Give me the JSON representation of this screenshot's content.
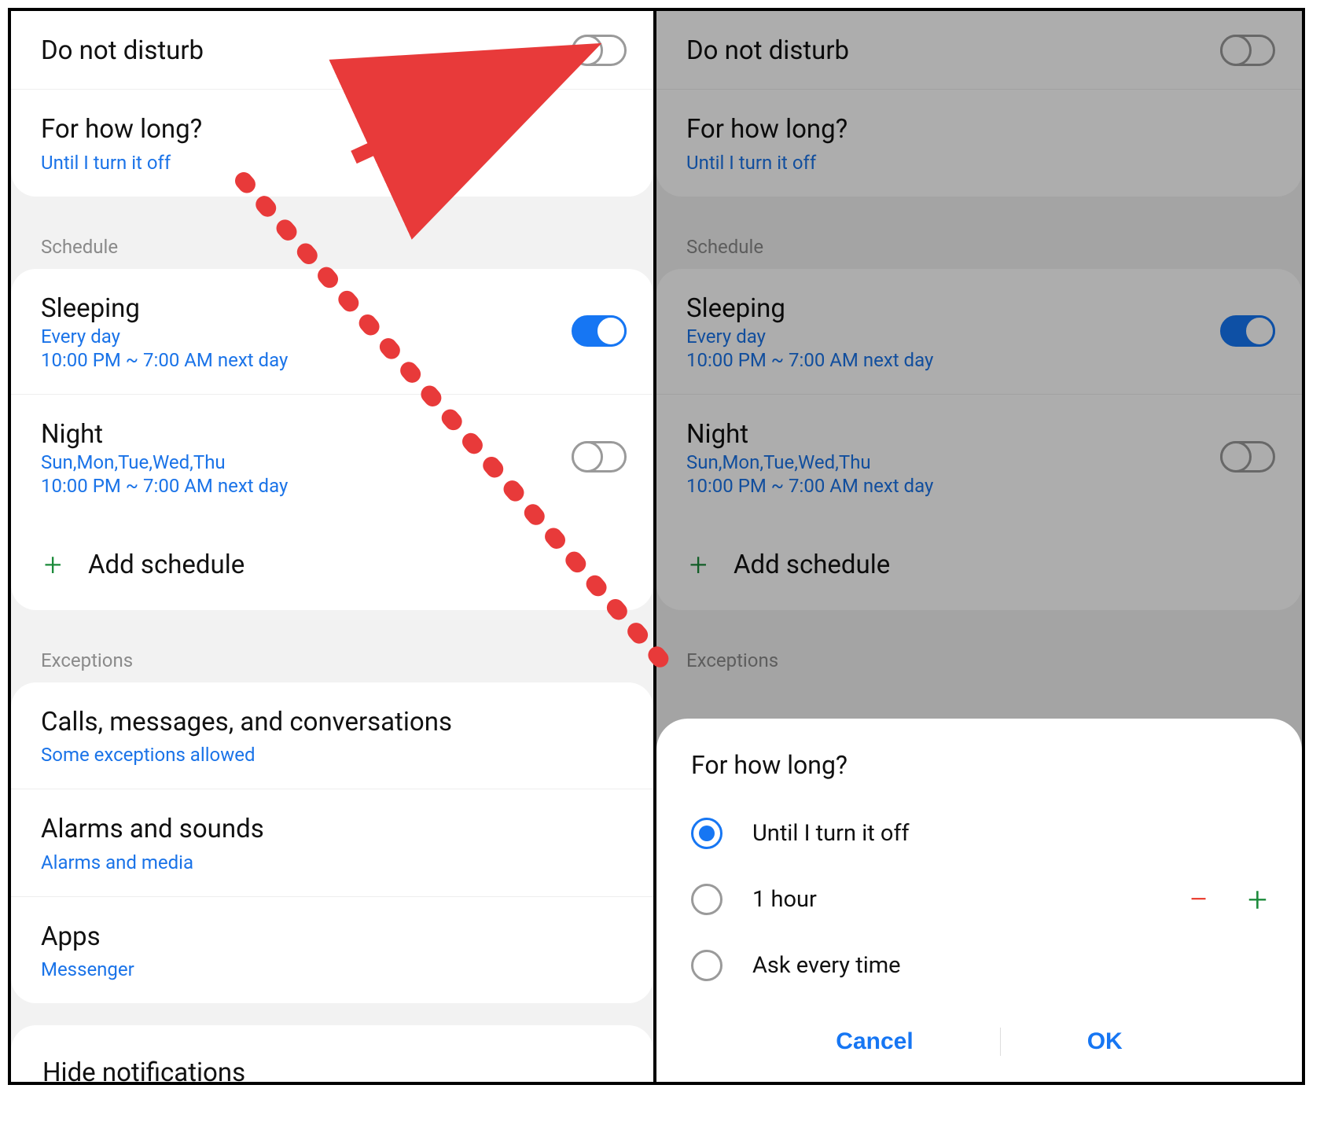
{
  "colors": {
    "accent": "#1676f3",
    "link": "#1a73e8",
    "annotation": "#e83a3a"
  },
  "left": {
    "dnd": {
      "title": "Do not disturb",
      "on": false
    },
    "duration": {
      "title": "For how long?",
      "value": "Until I turn it off"
    },
    "schedule": {
      "label": "Schedule",
      "items": [
        {
          "name": "Sleeping",
          "days": "Every day",
          "time": "10:00 PM ~ 7:00 AM next day",
          "on": true
        },
        {
          "name": "Night",
          "days": "Sun,Mon,Tue,Wed,Thu",
          "time": "10:00 PM ~ 7:00 AM next day",
          "on": false
        }
      ],
      "add_label": "Add schedule"
    },
    "exceptions": {
      "label": "Exceptions",
      "items": [
        {
          "title": "Calls, messages, and conversations",
          "sub": "Some exceptions allowed"
        },
        {
          "title": "Alarms and sounds",
          "sub": "Alarms and media"
        },
        {
          "title": "Apps",
          "sub": "Messenger"
        }
      ]
    },
    "hide": {
      "title": "Hide notifications"
    }
  },
  "right": {
    "dnd": {
      "title": "Do not disturb",
      "on": false
    },
    "duration": {
      "title": "For how long?",
      "value": "Until I turn it off"
    },
    "schedule": {
      "label": "Schedule",
      "items": [
        {
          "name": "Sleeping",
          "days": "Every day",
          "time": "10:00 PM ~ 7:00 AM next day",
          "on": true
        },
        {
          "name": "Night",
          "days": "Sun,Mon,Tue,Wed,Thu",
          "time": "10:00 PM ~ 7:00 AM next day",
          "on": false
        }
      ],
      "add_label": "Add schedule"
    },
    "exceptions": {
      "label": "Exceptions"
    },
    "dialog": {
      "title": "For how long?",
      "options": [
        {
          "label": "Until I turn it off",
          "selected": true,
          "stepper": false
        },
        {
          "label": "1 hour",
          "selected": false,
          "stepper": true
        },
        {
          "label": "Ask every time",
          "selected": false,
          "stepper": false
        }
      ],
      "cancel": "Cancel",
      "ok": "OK"
    }
  }
}
